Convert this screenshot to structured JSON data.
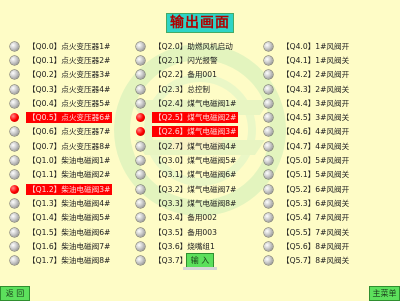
{
  "title": "输出画面",
  "columns": [
    [
      {
        "text": "【Q0.0】点火变压器1#",
        "on": false
      },
      {
        "text": "【Q0.1】点火变压器2#",
        "on": false
      },
      {
        "text": "【Q0.2】点火变压器3#",
        "on": false
      },
      {
        "text": "【Q0.3】点火变压器4#",
        "on": false
      },
      {
        "text": "【Q0.4】点火变压器5#",
        "on": false
      },
      {
        "text": "【Q0.5】点火变压器6#",
        "on": true
      },
      {
        "text": "【Q0.6】点火变压器7#",
        "on": false
      },
      {
        "text": "【Q0.7】点火变压器8#",
        "on": false
      },
      {
        "text": "【Q1.0】柴油电磁阀1#",
        "on": false
      },
      {
        "text": "【Q1.1】柴油电磁阀2#",
        "on": false
      },
      {
        "text": "【Q1.2】柴油电磁阀3#",
        "on": true
      },
      {
        "text": "【Q1.3】柴油电磁阀4#",
        "on": false
      },
      {
        "text": "【Q1.4】柴油电磁阀5#",
        "on": false
      },
      {
        "text": "【Q1.5】柴油电磁阀6#",
        "on": false
      },
      {
        "text": "【Q1.6】柴油电磁阀7#",
        "on": false
      },
      {
        "text": "【Q1.7】柴油电磁阀8#",
        "on": false
      }
    ],
    [
      {
        "text": "【Q2.0】助燃风机启动",
        "on": false
      },
      {
        "text": "【Q2.1】闪光报警",
        "on": false
      },
      {
        "text": "【Q2.2】备用001",
        "on": false
      },
      {
        "text": "【Q2.3】总控制",
        "on": false
      },
      {
        "text": "【Q2.4】煤气电磁阀1#",
        "on": false
      },
      {
        "text": "【Q2.5】煤气电磁阀2#",
        "on": true
      },
      {
        "text": "【Q2.6】煤气电磁阀3#",
        "on": true
      },
      {
        "text": "【Q2.7】煤气电磁阀4#",
        "on": false
      },
      {
        "text": "【Q3.0】煤气电磁阀5#",
        "on": false
      },
      {
        "text": "【Q3.1】煤气电磁阀6#",
        "on": false
      },
      {
        "text": "【Q3.2】煤气电磁阀7#",
        "on": false
      },
      {
        "text": "【Q3.3】煤气电磁阀8#",
        "on": false
      },
      {
        "text": "【Q3.4】备用002",
        "on": false
      },
      {
        "text": "【Q3.5】备用003",
        "on": false
      },
      {
        "text": "【Q3.6】烧嘴组1",
        "on": false
      },
      {
        "text": "【Q3.7】烧嘴组2",
        "on": false
      }
    ],
    [
      {
        "text": "【Q4.0】1#风阀开",
        "on": false
      },
      {
        "text": "【Q4.1】1#风阀关",
        "on": false
      },
      {
        "text": "【Q4.2】2#风阀开",
        "on": false
      },
      {
        "text": "【Q4.3】2#风阀关",
        "on": false
      },
      {
        "text": "【Q4.4】3#风阀开",
        "on": false
      },
      {
        "text": "【Q4.5】3#风阀关",
        "on": false
      },
      {
        "text": "【Q4.6】4#风阀开",
        "on": false
      },
      {
        "text": "【Q4.7】4#风阀关",
        "on": false
      },
      {
        "text": "【Q5.0】5#风阀开",
        "on": false
      },
      {
        "text": "【Q5.1】5#风阀关",
        "on": false
      },
      {
        "text": "【Q5.2】6#风阀开",
        "on": false
      },
      {
        "text": "【Q5.3】6#风阀关",
        "on": false
      },
      {
        "text": "【Q5.4】7#风阀开",
        "on": false
      },
      {
        "text": "【Q5.5】7#风阀关",
        "on": false
      },
      {
        "text": "【Q5.6】8#风阀开",
        "on": false
      },
      {
        "text": "【Q5.7】8#风阀关",
        "on": false
      }
    ]
  ],
  "buttons": {
    "back": "返 回",
    "input": "输 入",
    "menu": "主菜单"
  },
  "colors": {
    "background": "#fefcc6",
    "title_bg": "#2ed4c6",
    "title_text": "#b00000",
    "active": "#ff0000",
    "button": "#5ce05c"
  }
}
